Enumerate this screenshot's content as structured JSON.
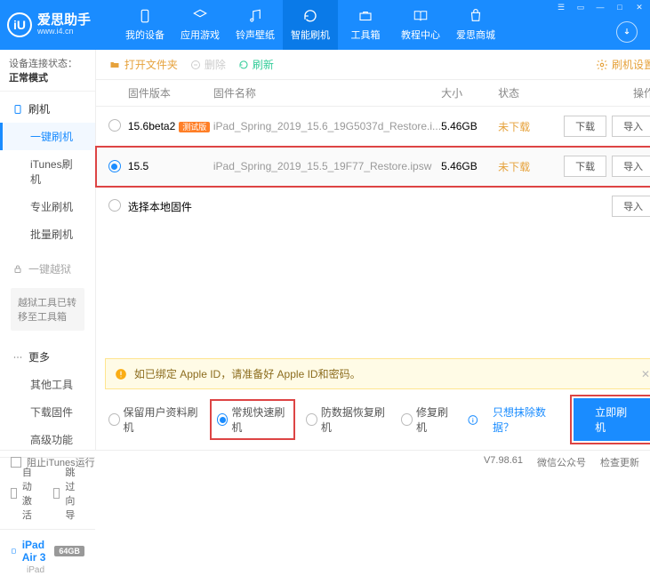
{
  "app": {
    "name": "爱思助手",
    "url": "www.i4.cn",
    "logo_letters": "iU"
  },
  "nav": [
    {
      "label": "我的设备"
    },
    {
      "label": "应用游戏"
    },
    {
      "label": "铃声壁纸"
    },
    {
      "label": "智能刷机"
    },
    {
      "label": "工具箱"
    },
    {
      "label": "教程中心"
    },
    {
      "label": "爱思商城"
    }
  ],
  "sidebar": {
    "conn_prefix": "设备连接状态：",
    "conn_status": "正常模式",
    "cat_flash": "刷机",
    "flash_items": [
      "一键刷机",
      "iTunes刷机",
      "专业刷机",
      "批量刷机"
    ],
    "cat_jail": "一键越狱",
    "jail_note": "越狱工具已转移至工具箱",
    "cat_more": "更多",
    "more_items": [
      "其他工具",
      "下载固件",
      "高级功能"
    ],
    "auto_activate": "自动激活",
    "skip_guide": "跳过向导",
    "device_name": "iPad Air 3",
    "device_storage": "64GB",
    "device_type": "iPad"
  },
  "toolbar": {
    "open": "打开文件夹",
    "delete": "删除",
    "refresh": "刷新",
    "settings": "刷机设置"
  },
  "table": {
    "h_ver": "固件版本",
    "h_name": "固件名称",
    "h_size": "大小",
    "h_status": "状态",
    "h_ops": "操作",
    "rows": [
      {
        "ver": "15.6beta2",
        "badge": "测试版",
        "name": "iPad_Spring_2019_15.6_19G5037d_Restore.i...",
        "size": "5.46GB",
        "status": "未下载",
        "selected": false
      },
      {
        "ver": "15.5",
        "badge": "",
        "name": "iPad_Spring_2019_15.5_19F77_Restore.ipsw",
        "size": "5.46GB",
        "status": "未下载",
        "selected": true
      }
    ],
    "local": "选择本地固件",
    "btn_download": "下载",
    "btn_import": "导入"
  },
  "warn": "如已绑定 Apple ID，请准备好 Apple ID和密码。",
  "options": {
    "o1": "保留用户资料刷机",
    "o2": "常规快速刷机",
    "o3": "防数据恢复刷机",
    "o4": "修复刷机",
    "link": "只想抹除数据？",
    "flash": "立即刷机"
  },
  "status": {
    "block": "阻止iTunes运行",
    "ver": "V7.98.61",
    "wx": "微信公众号",
    "upd": "检查更新"
  }
}
